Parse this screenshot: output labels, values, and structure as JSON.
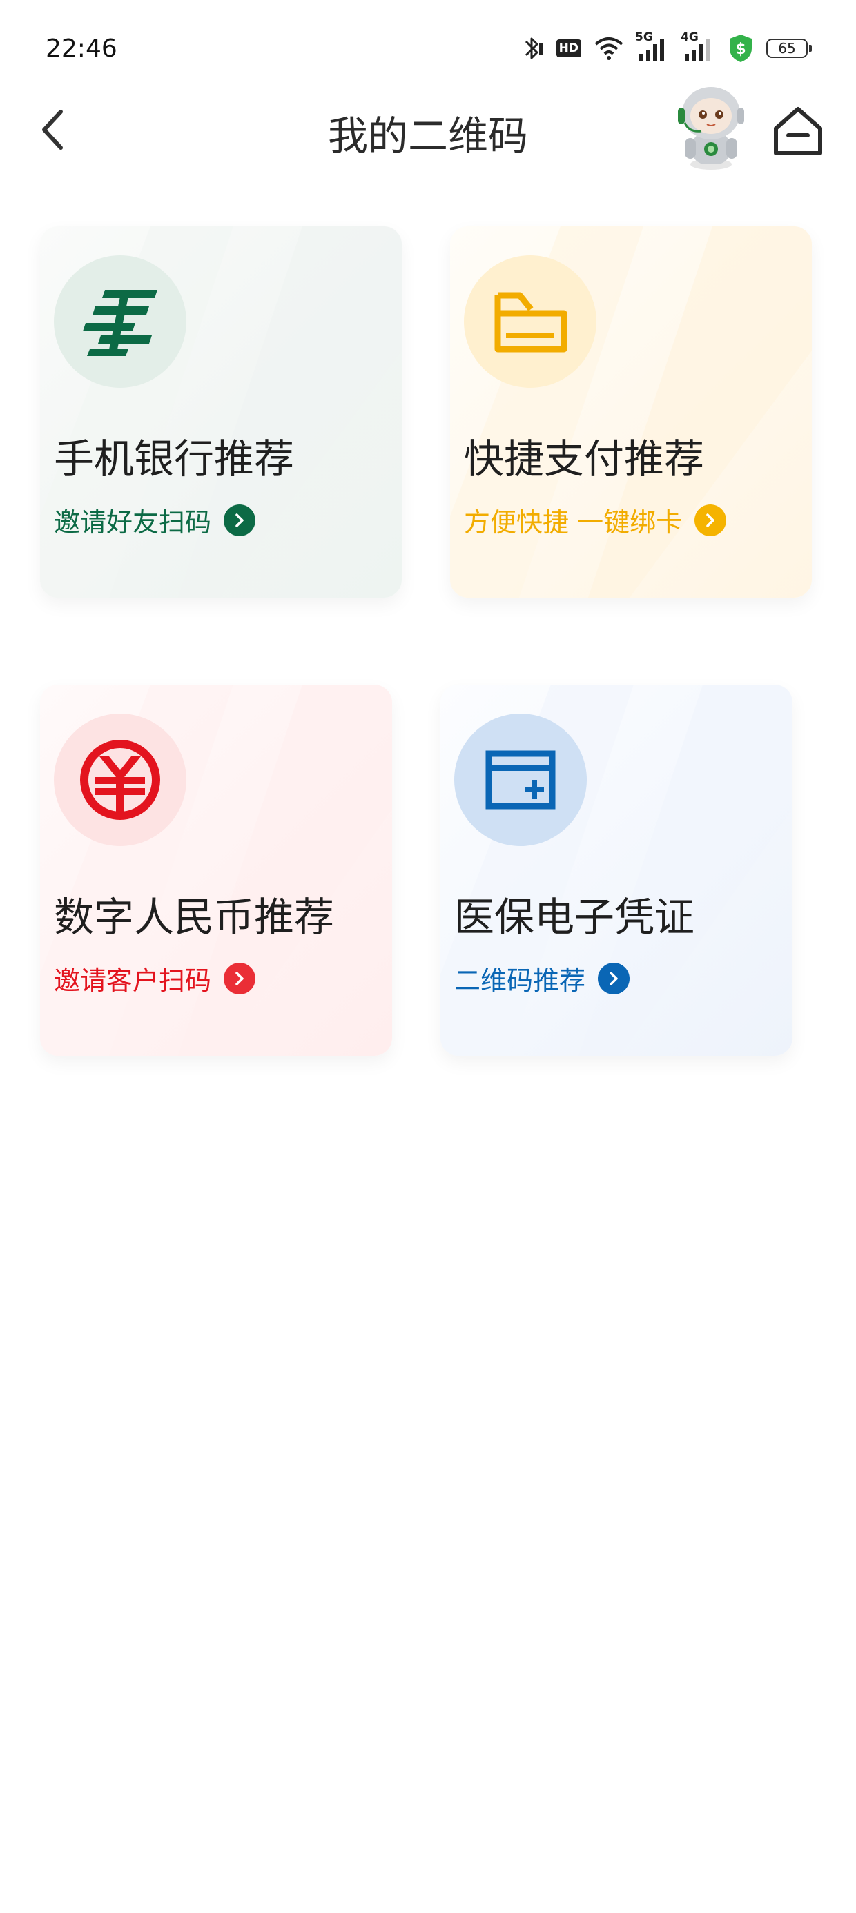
{
  "status_bar": {
    "time": "22:46",
    "hd_label": "HD",
    "net_5g": "5G",
    "net_4g": "4G",
    "battery": "65",
    "icons": [
      "bluetooth-icon",
      "hd-icon",
      "wifi-icon",
      "signal-5g-icon",
      "signal-4g-icon",
      "security-shield-icon",
      "battery-icon"
    ]
  },
  "header": {
    "title": "我的二维码",
    "back_icon": "chevron-left-icon",
    "home_icon": "home-icon",
    "mascot": "robot-mascot"
  },
  "colors": {
    "green": "#0c6a45",
    "yellow": "#f2ac00",
    "red": "#e3141e",
    "blue": "#0a66b5"
  },
  "cards": [
    {
      "title": "手机银行推荐",
      "link": "邀请好友扫码",
      "icon": "china-post-logo-icon",
      "accent": "#0c6a45"
    },
    {
      "title": "快捷支付推荐",
      "link": "方便快捷 一键绑卡",
      "icon": "card-payment-icon",
      "accent": "#f2ac00"
    },
    {
      "title": "数字人民币推荐",
      "link": "邀请客户扫码",
      "icon": "digital-rmb-icon",
      "accent": "#e3141e"
    },
    {
      "title": "医保电子凭证",
      "link": "二维码推荐",
      "icon": "medical-insurance-card-icon",
      "accent": "#0a66b5"
    }
  ]
}
